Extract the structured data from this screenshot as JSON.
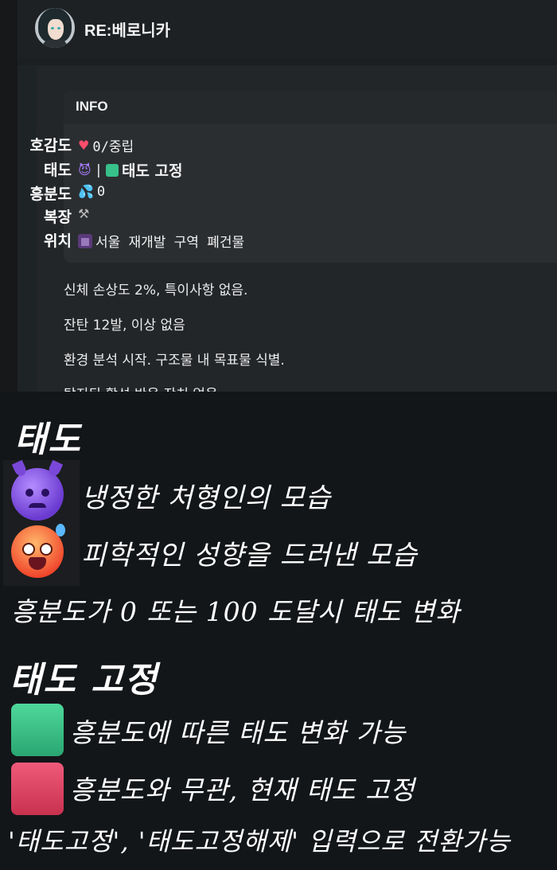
{
  "header": {
    "character_name": "RE:베로니카"
  },
  "info": {
    "title": "INFO",
    "stats": [
      {
        "label": "호감도",
        "value": "0/중립"
      },
      {
        "label": "태도",
        "value_sep": "|",
        "value_bold": "태도 고정"
      },
      {
        "label": "흥분도",
        "value": "0"
      },
      {
        "label": "복장",
        "value": ""
      },
      {
        "label": "위치",
        "value": "서울 재개발 구역 폐건물"
      }
    ]
  },
  "messages": [
    "신체 손상도 2%, 특이사항 없음.",
    "잔탄 12발, 이상 없음",
    "환경 분석 시작. 구조물 내 목표물 식별.",
    "탐지된 활성 반응 잔치 없음"
  ],
  "legend": {
    "attitude_title": "태도",
    "attitude_items": [
      {
        "icon": "smiling-devil-icon",
        "text": "냉정한 처형인의 모습"
      },
      {
        "icon": "hot-face-icon",
        "text": "피학적인 성향을 드러낸 모습"
      }
    ],
    "attitude_note": "흥분도가 0 또는 100 도달시 태도 변화",
    "fixed_title": "태도 고정",
    "fixed_items": [
      {
        "icon": "green-square-icon",
        "color": "#37c08a",
        "text": "흥분도에 따른 태도 변화 가능"
      },
      {
        "icon": "red-square-icon",
        "color": "#d93b5c",
        "text": "흥분도와 무관, 현재 태도 고정"
      }
    ],
    "fixed_note": "'태도고정', '태도고정해제' 입력으로 전환가능"
  }
}
